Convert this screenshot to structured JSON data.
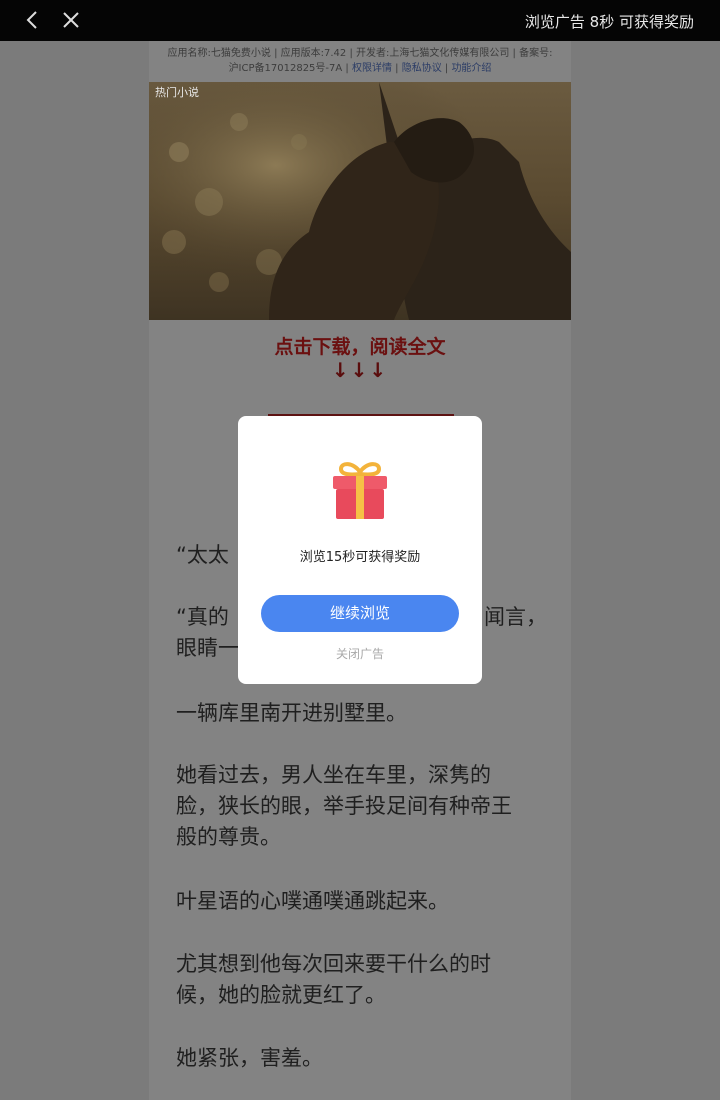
{
  "topbar": {
    "status_text": "浏览广告 8秒 可获得奖励"
  },
  "app_info": {
    "line1": "应用名称:七猫免费小说 | 应用版本:7.42 | 开发者:上海七猫文化传媒有限公司 | 备案号:",
    "line2_prefix": "沪ICP备17012825号-7A",
    "link_permissions": "权限详情",
    "link_privacy": "隐私协议",
    "link_features": "功能介绍",
    "sep": " | "
  },
  "hero": {
    "label": "热门小说"
  },
  "cta": {
    "text": "点击下载，阅读全文",
    "arrows": "↓↓↓"
  },
  "story": {
    "lines": [
      "“太太",
      "“真的",
      "眼睛一",
      "一辆库里南开进别墅里。",
      "她看过去，男人坐在车里，深隽的",
      "脸，狭长的眼，举手投足间有种帝王",
      "般的尊贵。",
      "叶星语的心噗通噗通跳起来。",
      "尤其想到他每次回来要干什么的时",
      "候，她的脸就更红了。",
      "她紧张，害羞。"
    ],
    "partial_right": "闻言，"
  },
  "modal": {
    "message": "浏览15秒可获得奖励",
    "continue_label": "继续浏览",
    "close_label": "关闭广告"
  },
  "colors": {
    "topbar": "#050505",
    "button": "#4a86f0",
    "cta_red": "#6b1010"
  }
}
